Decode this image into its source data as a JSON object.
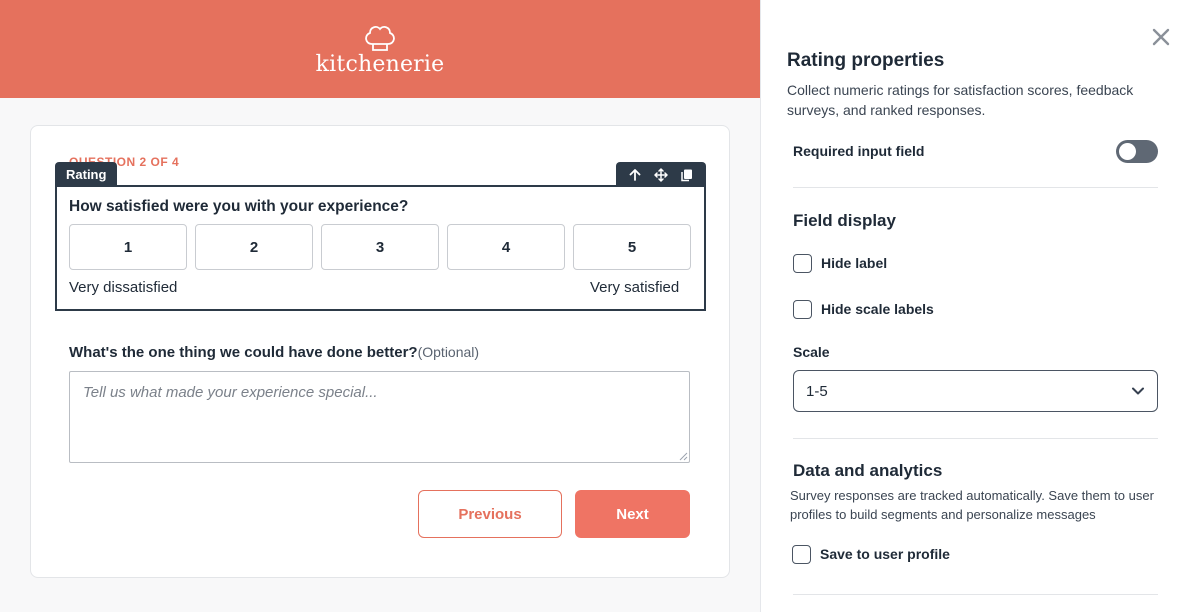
{
  "brand": {
    "logo_text": "kitchenerie",
    "logo_icon": "chef-hat-icon",
    "color": "#e5715d"
  },
  "survey": {
    "counter": "QUESTION 2 OF 4",
    "rating_tag": "Rating",
    "tools": [
      "move-up-icon",
      "drag-move-icon",
      "duplicate-icon"
    ],
    "rating_question": "How satisfied were you with your experience?",
    "scale_options": [
      "1",
      "2",
      "3",
      "4",
      "5"
    ],
    "scale_low_label": "Very dissatisfied",
    "scale_high_label": "Very satisfied",
    "improve_question": "What's the one thing we could have done better?",
    "improve_optional": "(Optional)",
    "improve_placeholder": "Tell us what made your experience special...",
    "previous_label": "Previous",
    "next_label": "Next"
  },
  "panel": {
    "close_icon": "close-icon",
    "title": "Rating properties",
    "description": "Collect numeric ratings for satisfaction scores, feedback surveys, and ranked responses.",
    "required_label": "Required input field",
    "required_on": false,
    "field_display_heading": "Field display",
    "hide_label": "Hide label",
    "hide_scale_labels": "Hide scale labels",
    "scale_label": "Scale",
    "scale_value": "1-5",
    "analytics_heading": "Data and analytics",
    "analytics_desc": "Survey responses are tracked automatically. Save them to user profiles to build segments and personalize messages",
    "save_profile_label": "Save to user profile"
  }
}
